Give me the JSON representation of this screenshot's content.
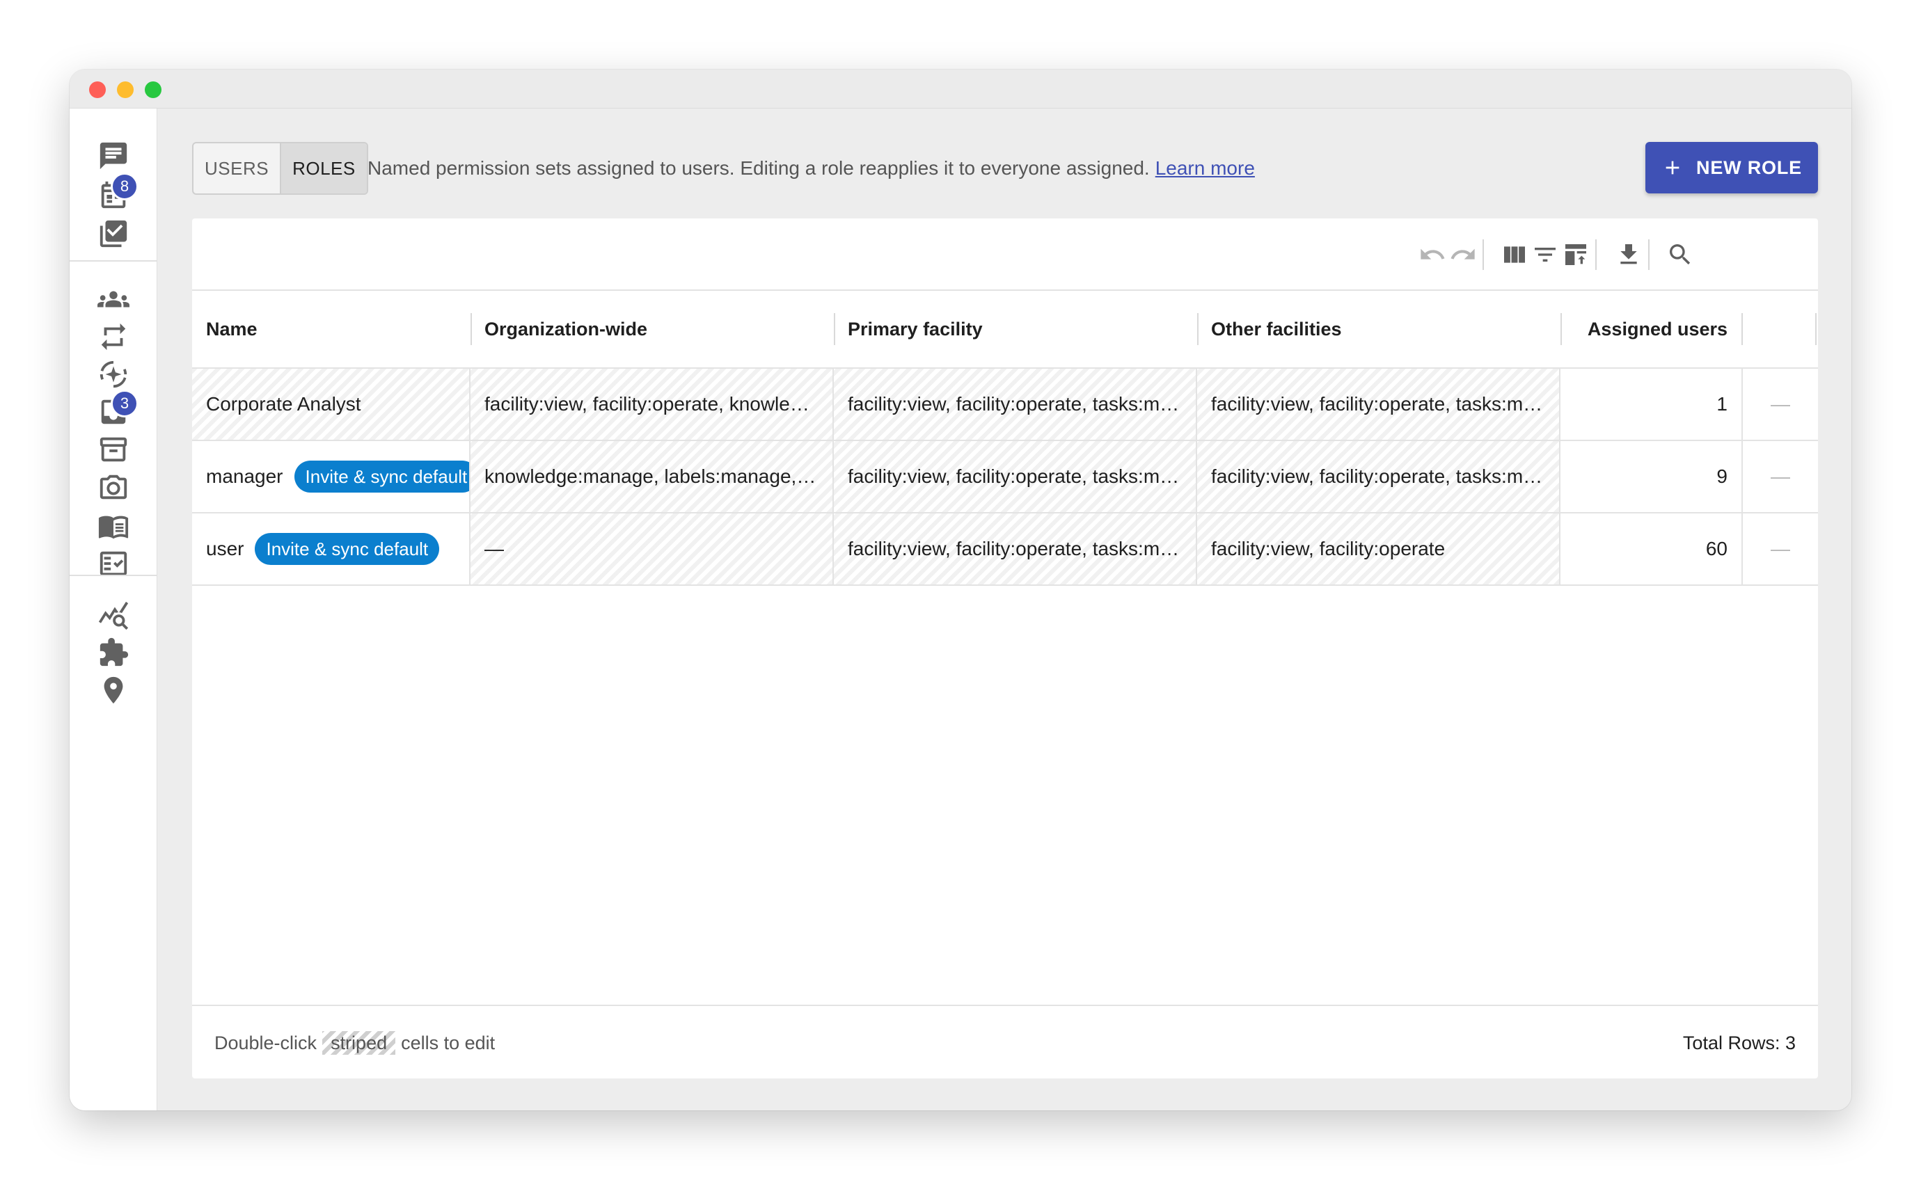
{
  "tabs": [
    {
      "label": "USERS",
      "active": false
    },
    {
      "label": "ROLES",
      "active": true
    }
  ],
  "description": "Named permission sets assigned to users. Editing a role reapplies it to everyone assigned.",
  "learn_more": "Learn more",
  "new_role_label": "NEW ROLE",
  "sidebar": {
    "items": [
      {
        "icon": "chat-icon"
      },
      {
        "icon": "schedule-icon",
        "badge": "8"
      },
      {
        "icon": "checklist-icon"
      },
      {
        "icon": "groups-icon"
      },
      {
        "icon": "sync-icon"
      },
      {
        "icon": "ai-sparkle-icon"
      },
      {
        "icon": "inbox-icon",
        "badge": "3"
      },
      {
        "icon": "archive-icon"
      },
      {
        "icon": "camera-icon"
      },
      {
        "icon": "knowledge-book-icon"
      },
      {
        "icon": "task-list-icon"
      },
      {
        "icon": "analytics-icon"
      },
      {
        "icon": "extension-icon"
      },
      {
        "icon": "location-pin-icon"
      }
    ]
  },
  "toolbar": [
    "undo-icon",
    "redo-icon",
    "columns-icon",
    "filter-icon",
    "density-icon",
    "download-icon",
    "search-icon"
  ],
  "table": {
    "columns": [
      "Name",
      "Organization-wide",
      "Primary facility",
      "Other facilities",
      "Assigned users"
    ],
    "rows": [
      {
        "name": "Corporate Analyst",
        "tag": "",
        "org": "facility:view, facility:operate, knowledge:manage, labels:manage",
        "primary": "facility:view, facility:operate, tasks:manage",
        "other": "facility:view, facility:operate, tasks:manage",
        "assigned": "1",
        "action": "—"
      },
      {
        "name": "manager",
        "tag": "Invite & sync default",
        "org": "knowledge:manage, labels:manage, integrations:manage",
        "primary": "facility:view, facility:operate, tasks:manage",
        "other": "facility:view, facility:operate, tasks:manage",
        "assigned": "9",
        "action": "—"
      },
      {
        "name": "user",
        "tag": "Invite & sync default",
        "org": "—",
        "primary": "facility:view, facility:operate, tasks:manage",
        "other": "facility:view, facility:operate",
        "assigned": "60",
        "action": "—"
      }
    ]
  },
  "footer": {
    "prefix": "Double-click",
    "striped": "striped",
    "suffix": "cells to edit",
    "total": "Total Rows: 3"
  },
  "colors": {
    "accent": "#3f51b5",
    "chip": "#0b7fce"
  }
}
